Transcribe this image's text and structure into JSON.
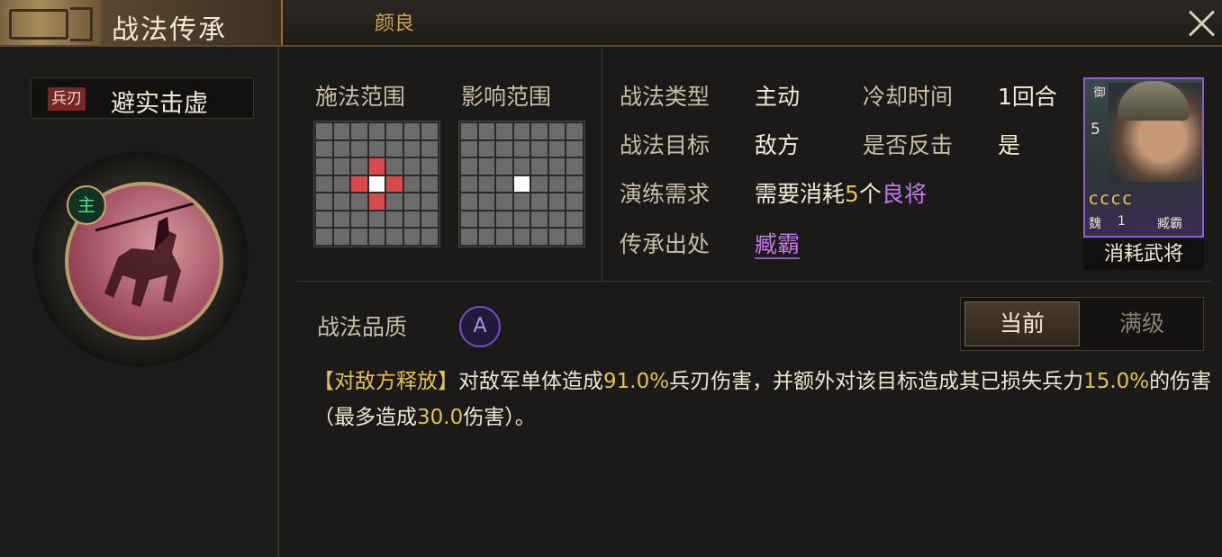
{
  "header": {
    "title": "战法传承",
    "general_name": "颜良"
  },
  "skill": {
    "type_tag": "兵刃",
    "name": "避实击虚",
    "main_badge": "主"
  },
  "ranges": {
    "cast_label": "施法范围",
    "effect_label": "影响范围"
  },
  "info": {
    "type_label": "战法类型",
    "type_value": "主动",
    "cooldown_label": "冷却时间",
    "cooldown_value": "1回合",
    "target_label": "战法目标",
    "target_value": "敌方",
    "counter_label": "是否反击",
    "counter_value": "是",
    "train_label": "演练需求",
    "train_prefix": "需要消耗",
    "train_count": "5",
    "train_unit": "个",
    "train_tier": "良将",
    "source_label": "传承出处",
    "source_value": "臧霸"
  },
  "card": {
    "arm": "御",
    "cost": "5",
    "stars": "cccc",
    "faction": "魏",
    "level": "1",
    "name": "臧霸",
    "caption": "消耗武将"
  },
  "quality": {
    "label": "战法品质",
    "grade": "A",
    "tab_current": "当前",
    "tab_max": "满级"
  },
  "description": {
    "tag": "【对敌方释放】",
    "part1": "对敌军单体造成",
    "pct1": "91.0%",
    "part2": "兵刃伤害，并额外对该目标造成其已损失兵力",
    "pct2": "15.0%",
    "part3": "的伤害（最多造成",
    "pct3": "30.0",
    "part4": "伤害）。"
  },
  "colors": {
    "accent_gold": "#e6c24a",
    "accent_purple": "#c47af0",
    "range_red": "#d94a4a"
  }
}
